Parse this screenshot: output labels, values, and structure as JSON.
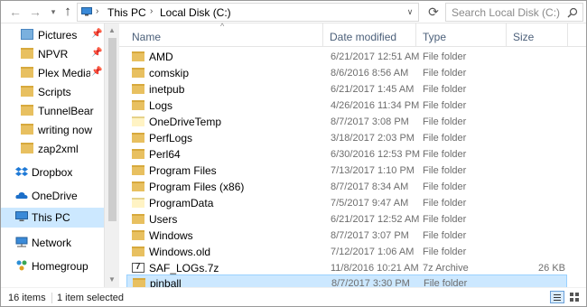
{
  "address": {
    "back_icon": "arrow-left-icon",
    "forward_icon": "arrow-right-icon",
    "up_icon": "arrow-up-icon",
    "crumbs": [
      "This PC",
      "Local Disk (C:)"
    ],
    "search_placeholder": "Search Local Disk (C:)"
  },
  "columns": {
    "name": "Name",
    "date": "Date modified",
    "type": "Type",
    "size": "Size"
  },
  "nav": {
    "quick_access": [
      {
        "label": "Pictures",
        "pinned": true
      },
      {
        "label": "NPVR",
        "pinned": true
      },
      {
        "label": "Plex Media Se",
        "pinned": true
      },
      {
        "label": "Scripts",
        "pinned": false
      },
      {
        "label": "TunnelBear",
        "pinned": false
      },
      {
        "label": "writing now",
        "pinned": false
      },
      {
        "label": "zap2xml",
        "pinned": false
      }
    ],
    "locations": [
      {
        "label": "Dropbox",
        "icon": "dropbox-icon"
      },
      {
        "label": "OneDrive",
        "icon": "onedrive-icon"
      },
      {
        "label": "This PC",
        "icon": "pc-icon",
        "selected": true
      },
      {
        "label": "Network",
        "icon": "network-icon"
      },
      {
        "label": "Homegroup",
        "icon": "homegroup-icon"
      }
    ]
  },
  "files": [
    {
      "name": "AMD",
      "date": "6/21/2017 12:51 AM",
      "type": "File folder",
      "size": ""
    },
    {
      "name": "comskip",
      "date": "8/6/2016 8:56 AM",
      "type": "File folder",
      "size": ""
    },
    {
      "name": "inetpub",
      "date": "6/21/2017 1:45 AM",
      "type": "File folder",
      "size": ""
    },
    {
      "name": "Logs",
      "date": "4/26/2016 11:34 PM",
      "type": "File folder",
      "size": ""
    },
    {
      "name": "OneDriveTemp",
      "date": "8/7/2017 3:08 PM",
      "type": "File folder",
      "size": ""
    },
    {
      "name": "PerfLogs",
      "date": "3/18/2017 2:03 PM",
      "type": "File folder",
      "size": ""
    },
    {
      "name": "Perl64",
      "date": "6/30/2016 12:53 PM",
      "type": "File folder",
      "size": ""
    },
    {
      "name": "Program Files",
      "date": "7/13/2017 1:10 PM",
      "type": "File folder",
      "size": ""
    },
    {
      "name": "Program Files (x86)",
      "date": "8/7/2017 8:34 AM",
      "type": "File folder",
      "size": ""
    },
    {
      "name": "ProgramData",
      "date": "7/5/2017 9:47 AM",
      "type": "File folder",
      "size": ""
    },
    {
      "name": "Users",
      "date": "6/21/2017 12:52 AM",
      "type": "File folder",
      "size": ""
    },
    {
      "name": "Windows",
      "date": "8/7/2017 3:07 PM",
      "type": "File folder",
      "size": ""
    },
    {
      "name": "Windows.old",
      "date": "7/12/2017 1:06 AM",
      "type": "File folder",
      "size": ""
    },
    {
      "name": "SAF_LOGs.7z",
      "date": "11/8/2016 10:21 AM",
      "type": "7z Archive",
      "size": "26 KB"
    },
    {
      "name": "pinball",
      "date": "8/7/2017 3:30 PM",
      "type": "File folder",
      "size": "",
      "selected": true
    }
  ],
  "status": {
    "item_count": "16 items",
    "selection": "1 item selected"
  }
}
